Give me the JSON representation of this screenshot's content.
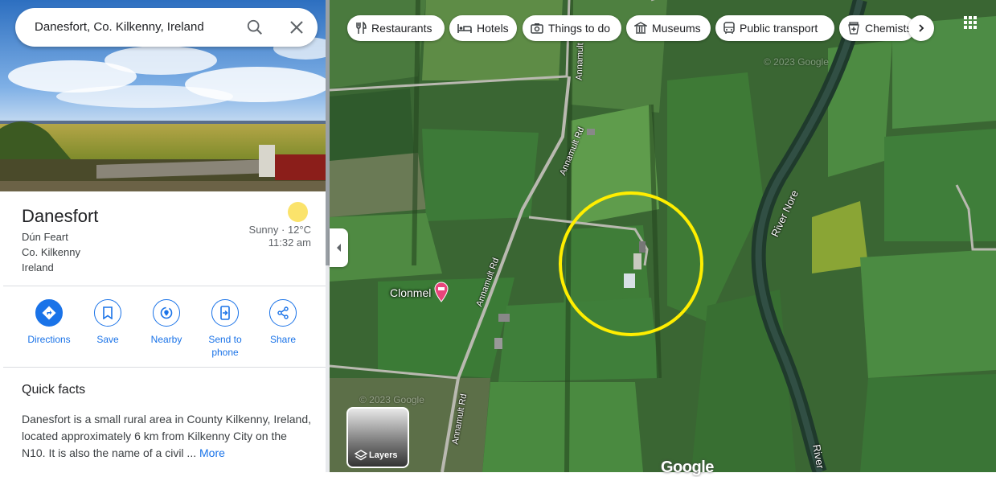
{
  "search": {
    "query": "Danesfort, Co. Kilkenny, Ireland"
  },
  "place": {
    "name": "Danesfort",
    "address_lines": [
      "Dún Feart",
      "Co. Kilkenny",
      "Ireland"
    ],
    "weather": {
      "condition": "Sunny · 12°C",
      "time": "11:32 am"
    }
  },
  "actions": [
    {
      "label": "Directions",
      "icon": "directions-icon"
    },
    {
      "label": "Save",
      "icon": "bookmark-icon"
    },
    {
      "label": "Nearby",
      "icon": "nearby-icon"
    },
    {
      "label": "Send to phone",
      "icon": "send-to-phone-icon"
    },
    {
      "label": "Share",
      "icon": "share-icon"
    }
  ],
  "quick_facts": {
    "title": "Quick facts",
    "text": "Danesfort is a small rural area in County Kilkenny, Ireland, located approximately 6 km from Kilkenny City on the N10. It is also the name of a civil ...",
    "more": "More"
  },
  "chips": [
    {
      "label": "Restaurants",
      "icon": "fork-knife-icon"
    },
    {
      "label": "Hotels",
      "icon": "bed-icon"
    },
    {
      "label": "Things to do",
      "icon": "camera-icon"
    },
    {
      "label": "Museums",
      "icon": "museum-icon"
    },
    {
      "label": "Public transport",
      "icon": "bus-icon"
    },
    {
      "label": "Chemists",
      "icon": "pharmacy-icon"
    }
  ],
  "map": {
    "place_label": "Clonmel",
    "roads": [
      "Annamult Rd",
      "Annamult Rd",
      "Annamult Rd",
      "Annamult Rd"
    ],
    "rivers": [
      "River Nore",
      "River"
    ],
    "layers_label": "Layers",
    "brand": "Google",
    "watermark": "© 2023 Google",
    "highlight_color": "#ffee00"
  },
  "colors": {
    "accent": "#1a73e8",
    "sun": "#fbe36b"
  }
}
